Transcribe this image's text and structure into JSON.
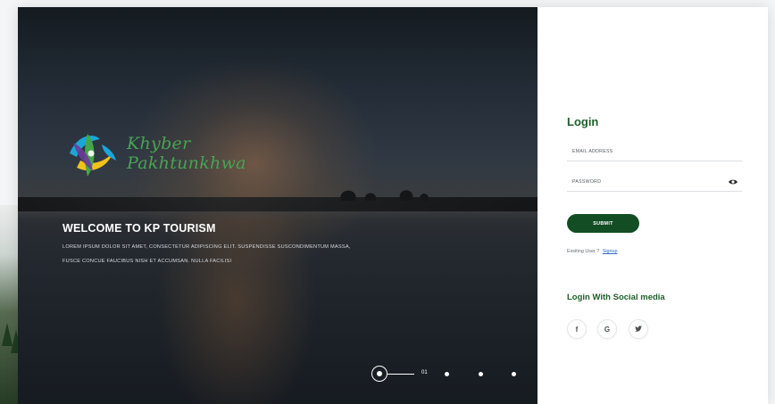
{
  "brand": {
    "name_line1": "Khyber",
    "name_line2": "Pakhtunkhwa"
  },
  "hero": {
    "heading": "WELCOME TO KP TOURISM",
    "text_line1": "LOREM IPSUM DOLOR SIT AMET, CONSECTETUR ADIPISCING ELIT. SUSPENDISSE SUSCONDIMENTUM MASSA,",
    "text_line2": "FUSCE CONCUE FAUCIBUS NISH ET ACCUMSAN. NULLA FACILISI",
    "slider": {
      "current": "01",
      "total_dots": 4,
      "active_index": 1
    }
  },
  "login": {
    "title": "Login",
    "email_placeholder": "EMAIL ADDRESS",
    "password_placeholder": "PASSWORD",
    "submit_label": "SUBMIT",
    "existing_user_text": "Exsiting User ?",
    "signup_link": "Signup",
    "social_title": "Login With  Social media",
    "social": [
      {
        "name": "facebook",
        "glyph": "f"
      },
      {
        "name": "google",
        "glyph": "G"
      },
      {
        "name": "twitter",
        "glyph": "t"
      }
    ]
  },
  "colors": {
    "brand_green": "#48a355",
    "title_green": "#1f5e2a",
    "button_green": "#124d23",
    "link_blue": "#2b6cc8"
  },
  "icons": {
    "logo": "kp-logo-icon",
    "eye": "eye-icon"
  }
}
